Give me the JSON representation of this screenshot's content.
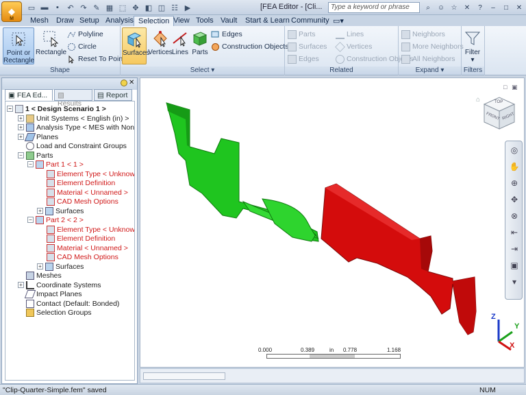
{
  "window": {
    "title": "[FEA Editor - [Cli...",
    "search_placeholder": "Type a keyword or phrase"
  },
  "app_button": {
    "label": "M"
  },
  "ribbon_tabs": [
    "Mesh",
    "Draw",
    "Setup",
    "Analysis",
    "Selection",
    "View",
    "Tools",
    "Vault",
    "Start & Learn",
    "Community"
  ],
  "ribbon_active_tab": "Selection",
  "ribbon": {
    "shape": {
      "label": "Shape",
      "point_or_rectangle": "Point or Rectangle",
      "rectangle": "Rectangle",
      "polyline": "Polyline",
      "circle": "Circle",
      "reset_to_point": "Reset To Point"
    },
    "select": {
      "label": "Select",
      "surfaces": "Surfaces",
      "vertices": "Vertices",
      "lines": "Lines",
      "parts": "Parts",
      "edges": "Edges",
      "construction_objects": "Construction Objects"
    },
    "related": {
      "label": "Related",
      "parts": "Parts",
      "surfaces": "Surfaces",
      "edges": "Edges",
      "lines": "Lines",
      "vertices": "Vertices",
      "construction_objects": "Construction Objects"
    },
    "expand": {
      "label": "Expand",
      "neighbors": "Neighbors",
      "more_neighbors": "More Neighbors",
      "all_neighbors": "All Neighbors"
    },
    "filters": {
      "label": "Filters",
      "filter": "Filter"
    }
  },
  "panel": {
    "tabs": [
      "FEA Ed...",
      "Results",
      "Report"
    ],
    "tree": [
      "1 < Design Scenario 1 >",
      "Unit Systems < English (in) >",
      "Analysis Type < MES with Nonline",
      "Planes",
      "Load and Constraint Groups",
      "Parts",
      "Part 1 < 1 >",
      "Element Type < Unknown",
      "Element Definition",
      "Material < Unnamed >",
      "CAD Mesh Options",
      "Surfaces",
      "Part 2 < 2 >",
      "Element Type < Unknown",
      "Element Definition",
      "Material < Unnamed >",
      "CAD Mesh Options",
      "Surfaces",
      "Meshes",
      "Coordinate Systems",
      "Impact Planes",
      "Contact (Default: Bonded)",
      "Selection Groups"
    ]
  },
  "viewcube": {
    "front": "FRONT",
    "right": "RIGHT",
    "top": "TOP"
  },
  "scale_bar": {
    "labels": [
      "0.000",
      "0.389",
      "in",
      "0.778",
      "1.168"
    ]
  },
  "triad": {
    "x": "X",
    "y": "Y",
    "z": "Z"
  },
  "status": {
    "message": "\"Clip-Quarter-Simple.fem\" saved",
    "num": "NUM"
  },
  "colors": {
    "part1": "#1fc51f",
    "part2": "#d40c0c",
    "accent": "#f6c960"
  }
}
